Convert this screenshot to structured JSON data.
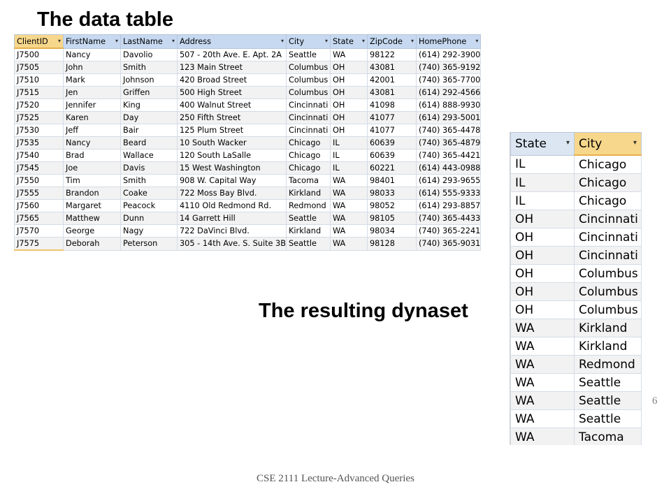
{
  "slide": {
    "title": "The data table",
    "subtitle": "The resulting dynaset",
    "page_number": "6",
    "footer": "CSE 2111 Lecture-Advanced Queries"
  },
  "data_table": {
    "columns": [
      "ClientID",
      "FirstName",
      "LastName",
      "Address",
      "City",
      "State",
      "ZipCode",
      "HomePhone"
    ],
    "rows": [
      [
        "J7500",
        "Nancy",
        "Davolio",
        "507 - 20th Ave. E. Apt. 2A",
        "Seattle",
        "WA",
        "98122",
        "(614) 292-3900"
      ],
      [
        "J7505",
        "John",
        "Smith",
        "123 Main Street",
        "Columbus",
        "OH",
        "43081",
        "(740) 365-9192"
      ],
      [
        "J7510",
        "Mark",
        "Johnson",
        "420 Broad Street",
        "Columbus",
        "OH",
        "42001",
        "(740) 365-7700"
      ],
      [
        "J7515",
        "Jen",
        "Griffen",
        "500 High Street",
        "Columbus",
        "OH",
        "43081",
        "(614) 292-4566"
      ],
      [
        "J7520",
        "Jennifer",
        "King",
        "400 Walnut Street",
        "Cincinnati",
        "OH",
        "41098",
        "(614) 888-9930"
      ],
      [
        "J7525",
        "Karen",
        "Day",
        "250 Fifth Street",
        "Cincinnati",
        "OH",
        "41077",
        "(614) 293-5001"
      ],
      [
        "J7530",
        "Jeff",
        "Bair",
        "125 Plum Street",
        "Cincinnati",
        "OH",
        "41077",
        "(740) 365-4478"
      ],
      [
        "J7535",
        "Nancy",
        "Beard",
        "10 South Wacker",
        "Chicago",
        "IL",
        "60639",
        "(740) 365-4879"
      ],
      [
        "J7540",
        "Brad",
        "Wallace",
        "120 South LaSalle",
        "Chicago",
        "IL",
        "60639",
        "(740) 365-4421"
      ],
      [
        "J7545",
        "Joe",
        "Davis",
        "15 West Washington",
        "Chicago",
        "IL",
        "60221",
        "(614) 443-0988"
      ],
      [
        "J7550",
        "Tim",
        "Smith",
        "908 W. Capital Way",
        "Tacoma",
        "WA",
        "98401",
        "(614) 293-9655"
      ],
      [
        "J7555",
        "Brandon",
        "Coake",
        "722 Moss Bay Blvd.",
        "Kirkland",
        "WA",
        "98033",
        "(614) 555-9333"
      ],
      [
        "J7560",
        "Margaret",
        "Peacock",
        "4110 Old Redmond Rd.",
        "Redmond",
        "WA",
        "98052",
        "(614) 293-8857"
      ],
      [
        "J7565",
        "Matthew",
        "Dunn",
        "14 Garrett Hill",
        "Seattle",
        "WA",
        "98105",
        "(740) 365-4433"
      ],
      [
        "J7570",
        "George",
        "Nagy",
        "722 DaVinci Blvd.",
        "Kirkland",
        "WA",
        "98034",
        "(740) 365-2241"
      ],
      [
        "J7575",
        "Deborah",
        "Peterson",
        "305 - 14th Ave. S. Suite 3B",
        "Seattle",
        "WA",
        "98128",
        "(740) 365-9031"
      ]
    ]
  },
  "dynaset": {
    "columns": [
      "State",
      "City"
    ],
    "rows": [
      [
        "IL",
        "Chicago"
      ],
      [
        "IL",
        "Chicago"
      ],
      [
        "IL",
        "Chicago"
      ],
      [
        "OH",
        "Cincinnati"
      ],
      [
        "OH",
        "Cincinnati"
      ],
      [
        "OH",
        "Cincinnati"
      ],
      [
        "OH",
        "Columbus"
      ],
      [
        "OH",
        "Columbus"
      ],
      [
        "OH",
        "Columbus"
      ],
      [
        "WA",
        "Kirkland"
      ],
      [
        "WA",
        "Kirkland"
      ],
      [
        "WA",
        "Redmond"
      ],
      [
        "WA",
        "Seattle"
      ],
      [
        "WA",
        "Seattle"
      ],
      [
        "WA",
        "Seattle"
      ],
      [
        "WA",
        "Tacoma"
      ]
    ]
  },
  "icons": {
    "column_dropdown": "dropdown-arrow-icon"
  },
  "colors": {
    "header_bg": "#c6d9f1",
    "selected_header_bg": "#f7d78b",
    "alt_row_bg": "#f2f2f2"
  }
}
